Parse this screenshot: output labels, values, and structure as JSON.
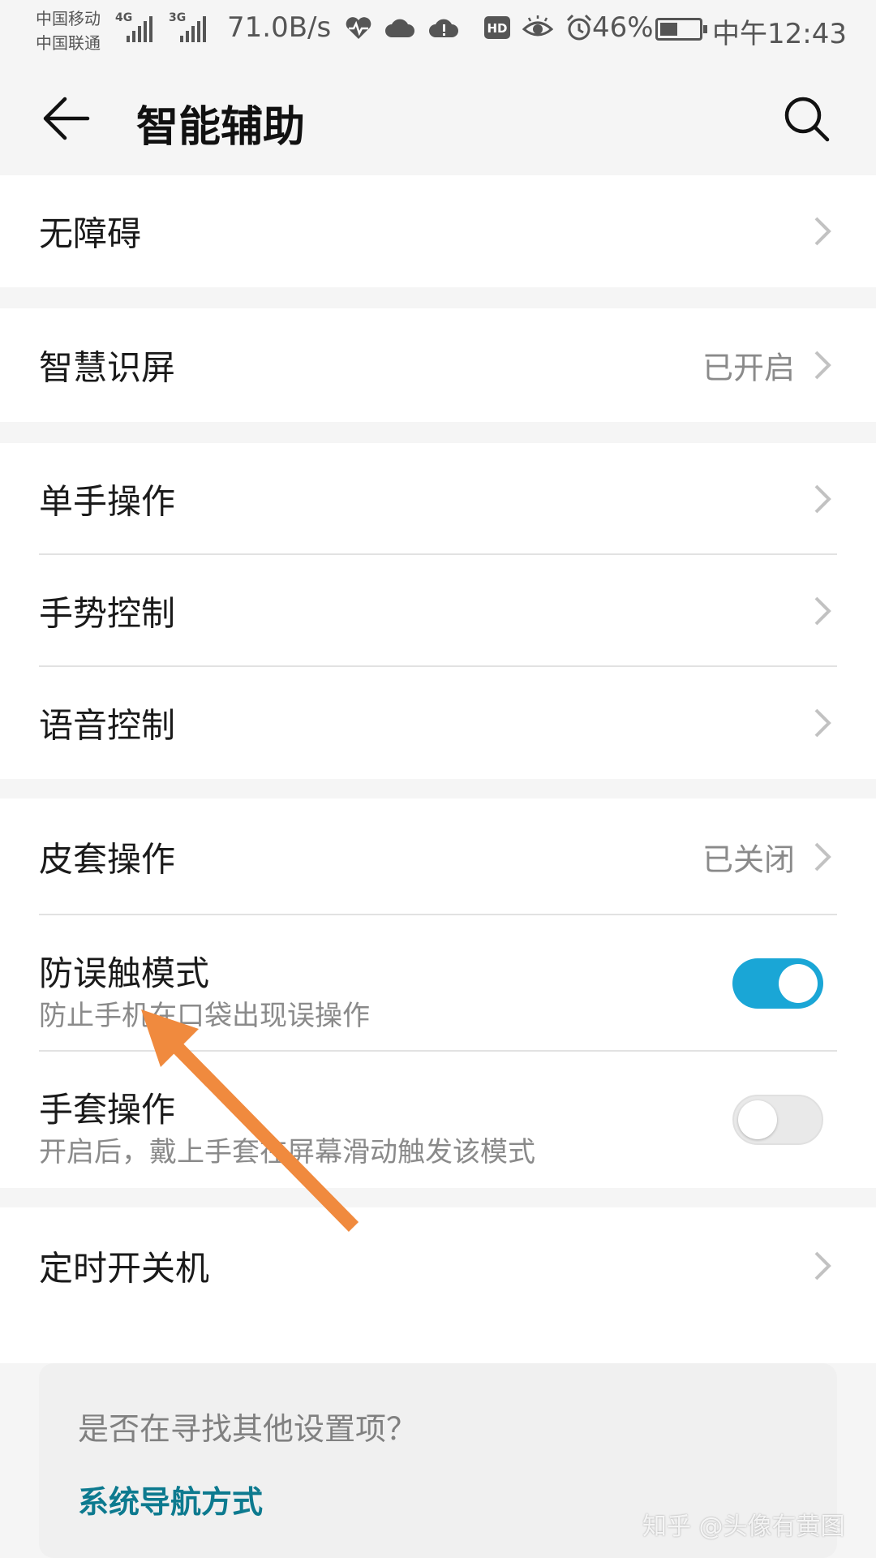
{
  "status_bar": {
    "carrier_1": "中国移动",
    "carrier_2": "中国联通",
    "network_1": "4G",
    "network_2": "3G",
    "net_speed": "71.0B/s",
    "battery": "46%",
    "battery_level": 0.46,
    "time": "中午12:43",
    "icons": [
      "heart-rate-icon",
      "cloud-icon",
      "cloud-alert-icon",
      "hd-icon",
      "eye-icon",
      "alarm-icon",
      "battery-icon"
    ]
  },
  "header": {
    "title": "智能辅助",
    "back_icon": "back-arrow-icon",
    "search_icon": "search-icon"
  },
  "groups": {
    "g1": {
      "items": [
        {
          "label": "无障碍"
        }
      ]
    },
    "g2": {
      "items": [
        {
          "label": "智慧识屏",
          "value": "已开启"
        }
      ]
    },
    "g3": {
      "items": [
        {
          "label": "单手操作"
        },
        {
          "label": "手势控制"
        },
        {
          "label": "语音控制"
        }
      ]
    },
    "g4": {
      "items": [
        {
          "label": "皮套操作",
          "value": "已关闭"
        },
        {
          "label": "防误触模式",
          "sub": "防止手机在口袋出现误操作",
          "toggle": true
        },
        {
          "label": "手套操作",
          "sub": "开启后，戴上手套在屏幕滑动触发该模式",
          "toggle": false
        }
      ]
    },
    "g5": {
      "items": [
        {
          "label": "定时开关机"
        }
      ]
    }
  },
  "suggest": {
    "question": "是否在寻找其他设置项？",
    "link": "系统导航方式"
  },
  "watermark": "知乎 @头像有黄图",
  "colors": {
    "accent": "#1aa6d6",
    "link": "#0d7a8f",
    "annotation_arrow": "#f08a3e",
    "background": "#f5f5f5"
  }
}
